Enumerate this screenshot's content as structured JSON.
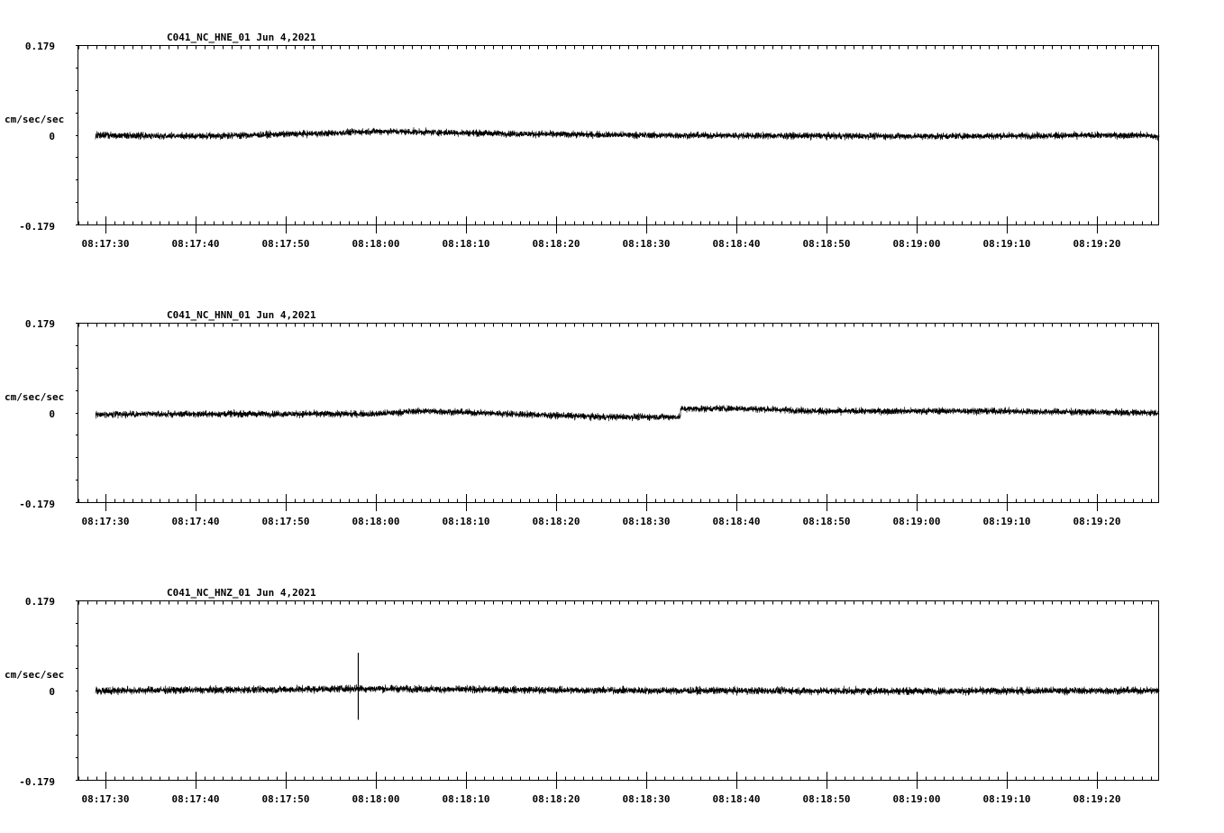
{
  "chart_data": [
    {
      "type": "line",
      "title": "C041_NC_HNE_01   Jun 4,2021",
      "ylabel": "cm/sec/sec",
      "ylim": [
        -0.179,
        0.179
      ],
      "y_ticks": [
        "0.179",
        "0",
        "-0.179"
      ],
      "x_tick_labels": [
        "08:17:30",
        "08:17:40",
        "08:17:50",
        "08:18:00",
        "08:18:10",
        "08:18:20",
        "08:18:30",
        "08:18:40",
        "08:18:50",
        "08:19:00",
        "08:19:10",
        "08:19:20"
      ],
      "xlim_seconds": [
        -1.6,
        58.3
      ],
      "trace_start_seconds": -1.1,
      "noise_amplitude": 0.0095,
      "trend": [
        [
          -1.1,
          0.0
        ],
        [
          10,
          -0.002
        ],
        [
          25,
          0.004
        ],
        [
          30,
          0.008
        ],
        [
          45,
          0.003
        ],
        [
          60,
          0.0
        ],
        [
          90,
          -0.002
        ],
        [
          115,
          0.0
        ],
        [
          117,
          -0.004
        ]
      ],
      "spikes": [],
      "color": "#000000"
    },
    {
      "type": "line",
      "title": "C041_NC_HNN_01   Jun 4,2021",
      "ylabel": "cm/sec/sec",
      "ylim": [
        -0.179,
        0.179
      ],
      "y_ticks": [
        "0.179",
        "0",
        "-0.179"
      ],
      "x_tick_labels": [
        "08:17:30",
        "08:17:40",
        "08:17:50",
        "08:18:00",
        "08:18:10",
        "08:18:20",
        "08:18:30",
        "08:18:40",
        "08:18:50",
        "08:19:00",
        "08:19:10",
        "08:19:20"
      ],
      "xlim_seconds": [
        -1.6,
        58.3
      ],
      "trace_start_seconds": -1.1,
      "noise_amplitude": 0.0095,
      "trend": [
        [
          -1.1,
          -0.003
        ],
        [
          15,
          -0.002
        ],
        [
          30,
          -0.002
        ],
        [
          35,
          0.004
        ],
        [
          45,
          -0.002
        ],
        [
          55,
          -0.008
        ],
        [
          63.7,
          -0.008
        ],
        [
          63.8,
          0.008
        ],
        [
          70,
          0.009
        ],
        [
          80,
          0.003
        ],
        [
          95,
          0.004
        ],
        [
          117,
          0.0
        ]
      ],
      "spikes": [],
      "color": "#000000"
    },
    {
      "type": "line",
      "title": "C041_NC_HNZ_01   Jun 4,2021",
      "ylabel": "cm/sec/sec",
      "ylim": [
        -0.179,
        0.179
      ],
      "y_ticks": [
        "0.179",
        "0",
        "-0.179"
      ],
      "x_tick_labels": [
        "08:17:30",
        "08:17:40",
        "08:17:50",
        "08:18:00",
        "08:18:10",
        "08:18:20",
        "08:18:30",
        "08:18:40",
        "08:18:50",
        "08:19:00",
        "08:19:10",
        "08:19:20"
      ],
      "xlim_seconds": [
        -1.6,
        58.3
      ],
      "trace_start_seconds": -1.1,
      "noise_amplitude": 0.0105,
      "trend": [
        [
          -1.1,
          0.0
        ],
        [
          20,
          0.002
        ],
        [
          28,
          0.004
        ],
        [
          40,
          0.002
        ],
        [
          60,
          0.0
        ],
        [
          90,
          -0.001
        ],
        [
          117,
          0.0
        ]
      ],
      "spikes": [
        [
          28,
          0.075,
          -0.058
        ]
      ],
      "color": "#000000"
    }
  ]
}
